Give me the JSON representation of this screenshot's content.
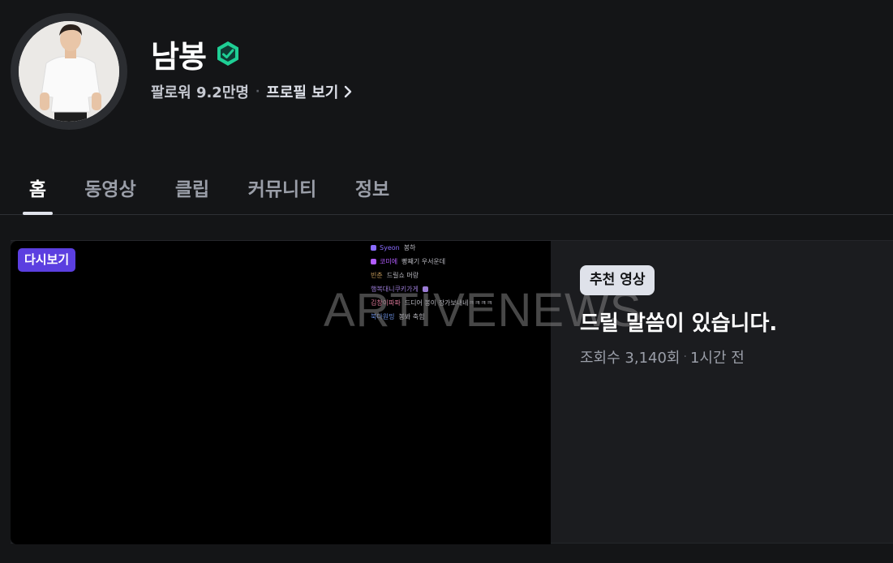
{
  "channel": {
    "name": "남봉",
    "followers": "팔로워 9.2만명",
    "profile_link": "프로필 보기"
  },
  "tabs": [
    {
      "label": "홈",
      "active": true
    },
    {
      "label": "동영상",
      "active": false
    },
    {
      "label": "클립",
      "active": false
    },
    {
      "label": "커뮤니티",
      "active": false
    },
    {
      "label": "정보",
      "active": false
    }
  ],
  "featured": {
    "badge": "다시보기",
    "category_badge": "추천 영상",
    "title": "드릴 말씀이 있습니다.",
    "views": "조회수 3,140회",
    "time_ago": "1시간 전",
    "watermark": "ARTIVENEWS",
    "chat": [
      {
        "nick": "Syeon",
        "msg": "봉하",
        "color": "#8a6cff"
      },
      {
        "nick": "코미에",
        "msg": "빵째기 우서운데",
        "color": "#b25cff"
      },
      {
        "nick": "빈춘",
        "msg": "드릴쇼 머랑",
        "color": "#c49a5a"
      },
      {
        "nick": "행복대니쿠키가게",
        "msg": "",
        "color": "#9b7cd6"
      },
      {
        "nick": "김창이파파",
        "msg": "드디어 봉이 장가보내네ㅋㅋㅋㅋ",
        "color": "#e07a9b"
      },
      {
        "nick": "북다원밍",
        "msg": "봉봐 축힘",
        "color": "#6a8ee0"
      }
    ]
  },
  "colors": {
    "background": "#141517",
    "accent_badge": "#5b3fe0",
    "verified": "#1fcf95"
  },
  "icons": {
    "verified": "verified-check-icon",
    "chevron": "chevron-right-icon"
  }
}
